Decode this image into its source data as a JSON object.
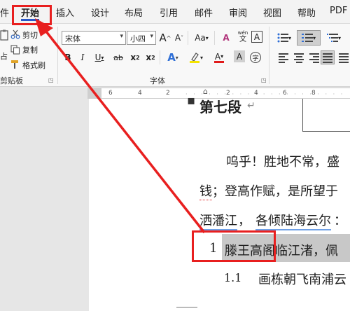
{
  "menu": {
    "items": [
      "件",
      "开始",
      "插入",
      "设计",
      "布局",
      "引用",
      "邮件",
      "审阅",
      "视图",
      "帮助",
      "PDF"
    ]
  },
  "clipboard": {
    "cut": "剪切",
    "copy": "复制",
    "format_painter": "格式刷",
    "paste_partial": "占",
    "label": "剪贴板"
  },
  "font": {
    "name": "宋体",
    "size": "小四",
    "label": "字体",
    "grow": "A",
    "shrink": "A",
    "change_case": "Aa",
    "clear_format": "A",
    "phonetic_top": "wén",
    "phonetic_bottom": "文",
    "char_border": "A",
    "bold": "B",
    "italic": "I",
    "underline": "U",
    "strike": "ab",
    "subscript": "x",
    "subscript_mark": "2",
    "superscript": "x",
    "superscript_mark": "2",
    "text_effect": "A",
    "font_color": "A",
    "char_shading": "A",
    "enclose": "字"
  },
  "ruler": {
    "numbers": [
      "6",
      "4",
      "2",
      "2",
      "4",
      "6",
      "8"
    ]
  },
  "document": {
    "heading": "第七段",
    "paragraph_line1": "呜乎！胜地不常，盛",
    "paragraph_line2_a": "钱",
    "paragraph_line2_b": "；登高作赋，是所望于",
    "paragraph_line3_a": "洒潘江",
    "paragraph_line3_b": "，",
    "paragraph_line3_c": "各倾陆海云尔",
    "paragraph_line3_d": "：",
    "list_number": "1",
    "list_text": "滕王高阁临江渚，佩",
    "sub_number": "1.1",
    "sub_text": "画栋朝飞南浦云"
  },
  "colors": {
    "accent": "#2b57c7",
    "annotation_red": "#e81f1f",
    "highlight_gray": "#c8c8c8"
  }
}
